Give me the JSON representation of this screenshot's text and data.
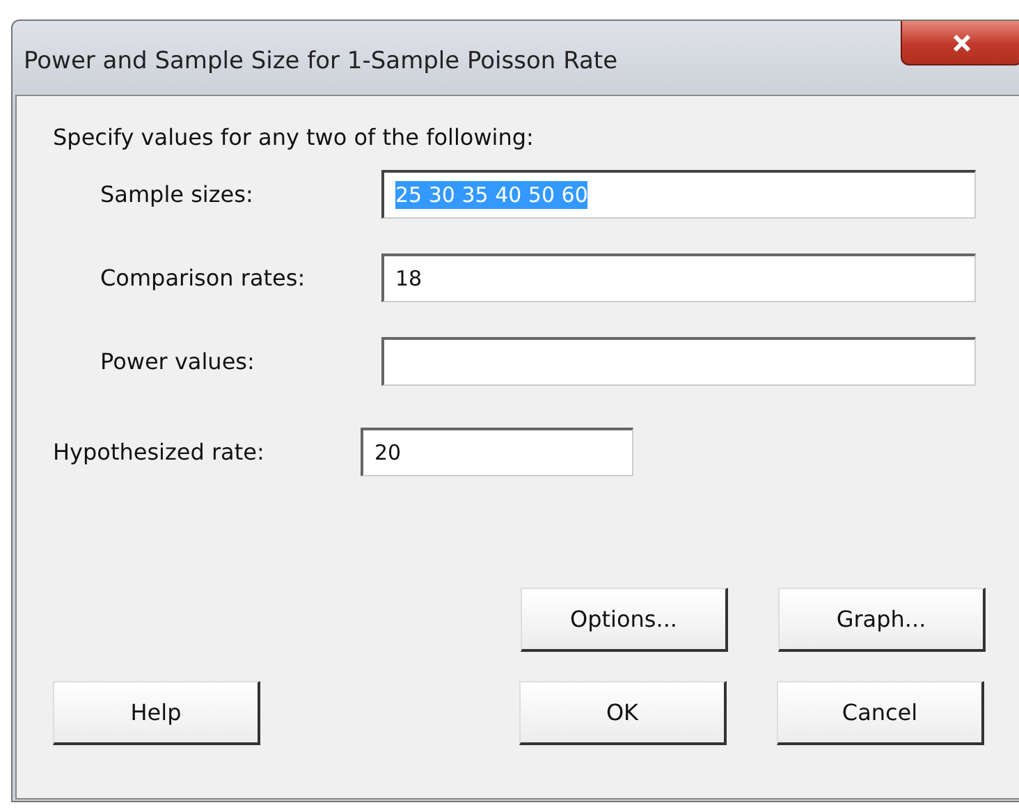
{
  "window": {
    "title": "Power and Sample Size for 1-Sample Poisson Rate"
  },
  "instruction": "Specify values for any two of the following:",
  "fields": [
    {
      "label": "Sample sizes:",
      "value": "25 30 35 40 50 60",
      "selected": true
    },
    {
      "label": "Comparison rates:",
      "value": "18",
      "selected": false
    },
    {
      "label": "Power values:",
      "selected": false
    }
  ],
  "hypothesized": {
    "label": "Hypothesized rate:",
    "value": "20"
  },
  "button_rows": [
    [
      "Options...",
      "Graph..."
    ],
    [
      "Help",
      "OK",
      "Cancel"
    ]
  ]
}
